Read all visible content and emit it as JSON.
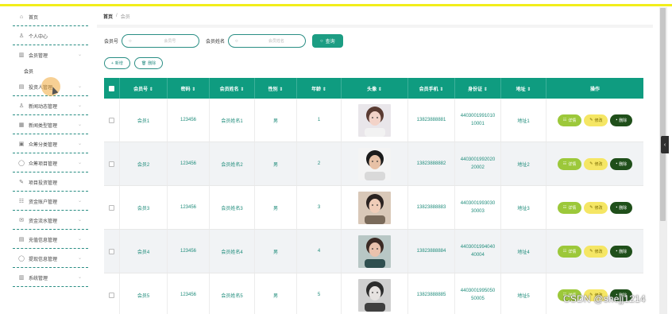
{
  "sidebar": {
    "items": [
      {
        "label": "首页",
        "icon": "home-icon",
        "glyph": "⌂",
        "chevron": false
      },
      {
        "label": "个人中心",
        "icon": "user-icon",
        "glyph": "♙",
        "chevron": false
      },
      {
        "label": "会员管理",
        "icon": "grid-icon",
        "glyph": "▥",
        "chevron": true,
        "sub": "会员"
      },
      {
        "label": "投资人管理",
        "icon": "list-icon",
        "glyph": "▤",
        "chevron": true
      },
      {
        "label": "新闻动态管理",
        "icon": "person-icon",
        "glyph": "♙",
        "chevron": true
      },
      {
        "label": "新闻类型管理",
        "icon": "table-icon",
        "glyph": "▦",
        "chevron": true
      },
      {
        "label": "众筹分类管理",
        "icon": "doc-icon",
        "glyph": "▣",
        "chevron": true
      },
      {
        "label": "众筹项目管理",
        "icon": "circle-icon",
        "glyph": "◯",
        "chevron": true
      },
      {
        "label": "项目投资管理",
        "icon": "edit-icon",
        "glyph": "✎",
        "chevron": false
      },
      {
        "label": "资金账户管理",
        "icon": "columns-icon",
        "glyph": "☷",
        "chevron": true
      },
      {
        "label": "资金流水管理",
        "icon": "mail-icon",
        "glyph": "✉",
        "chevron": true
      },
      {
        "label": "充值信息管理",
        "icon": "stack-icon",
        "glyph": "▤",
        "chevron": true
      },
      {
        "label": "提现信息管理",
        "icon": "info-icon",
        "glyph": "◯",
        "chevron": true
      },
      {
        "label": "系统管理",
        "icon": "bar-chart-icon",
        "glyph": "▥",
        "chevron": true
      }
    ]
  },
  "breadcrumb": {
    "home": "首页",
    "sep": "/",
    "current": "会员"
  },
  "search": {
    "field1_label": "会员号",
    "field1_placeholder": "会员号",
    "field2_label": "会员姓名",
    "field2_placeholder": "会员姓名",
    "button": "查询"
  },
  "actions": {
    "add": "新增",
    "delete": "删除"
  },
  "table": {
    "headers": [
      "会员号 ⇕",
      "密码 ⇕",
      "会员姓名 ⇕",
      "性别 ⇕",
      "年龄 ⇕",
      "头像 ⇕",
      "会员手机 ⇕",
      "身份证 ⇕",
      "地址 ⇕",
      "操作"
    ],
    "rows": [
      {
        "id": "会员1",
        "password": "123456",
        "name": "会员姓名1",
        "sex": "男",
        "age": "1",
        "phone": "13823888881",
        "card": "440300199101010001",
        "address": "地址1"
      },
      {
        "id": "会员2",
        "password": "123456",
        "name": "会员姓名2",
        "sex": "男",
        "age": "2",
        "phone": "13823888882",
        "card": "440300199202020002",
        "address": "地址2"
      },
      {
        "id": "会员3",
        "password": "123456",
        "name": "会员姓名3",
        "sex": "男",
        "age": "3",
        "phone": "13823888883",
        "card": "440300199303030003",
        "address": "地址3"
      },
      {
        "id": "会员4",
        "password": "123456",
        "name": "会员姓名4",
        "sex": "男",
        "age": "4",
        "phone": "13823888884",
        "card": "440300199404040004",
        "address": "地址4"
      },
      {
        "id": "会员5",
        "password": "123456",
        "name": "会员姓名5",
        "sex": "男",
        "age": "5",
        "phone": "13823888885",
        "card": "440300199505050005",
        "address": "地址5"
      }
    ],
    "op_view": "详情",
    "op_edit": "修改",
    "op_delete": "删除"
  },
  "watermark": "CSDN @shejj1214",
  "colors": {
    "accent": "#0f9c80",
    "view": "#9cc83a",
    "edit": "#f5e664",
    "delete": "#1f4f1a",
    "topbar": "#f2ee1a"
  }
}
